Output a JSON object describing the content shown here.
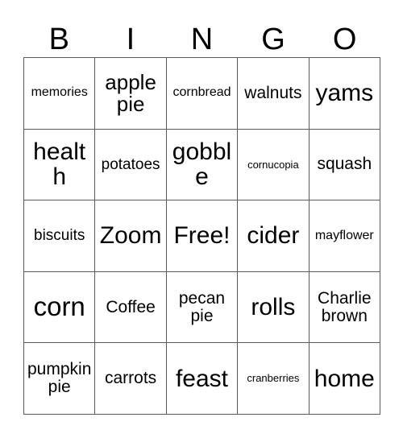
{
  "card": {
    "title": "Bingo Card",
    "header_letters": [
      "B",
      "I",
      "N",
      "G",
      "O"
    ],
    "border_color": "#5a5a5a",
    "background_color": "#ffffff",
    "text_color": "#000000",
    "grid_size": "5x5",
    "free_space": "Free!"
  },
  "grid": {
    "rows": [
      {
        "cells": [
          {
            "text": "memories",
            "size": "sz-s"
          },
          {
            "text": "apple pie",
            "size": "sz-l"
          },
          {
            "text": "cornbread",
            "size": "sz-s"
          },
          {
            "text": "walnuts",
            "size": "sz-ml"
          },
          {
            "text": "yams",
            "size": "sz-xl"
          }
        ]
      },
      {
        "cells": [
          {
            "text": "health",
            "size": "sz-xl"
          },
          {
            "text": "potatoes",
            "size": "sz-m"
          },
          {
            "text": "gobble",
            "size": "sz-xl"
          },
          {
            "text": "cornucopia",
            "size": "sz-xs"
          },
          {
            "text": "squash",
            "size": "sz-ml"
          }
        ]
      },
      {
        "cells": [
          {
            "text": "biscuits",
            "size": "sz-m"
          },
          {
            "text": "Zoom",
            "size": "sz-xl"
          },
          {
            "text": "Free!",
            "size": "sz-xl"
          },
          {
            "text": "cider",
            "size": "sz-xl"
          },
          {
            "text": "mayflower",
            "size": "sz-s"
          }
        ]
      },
      {
        "cells": [
          {
            "text": "corn",
            "size": "sz-xxl"
          },
          {
            "text": "Coffee",
            "size": "sz-ml"
          },
          {
            "text": "pecan pie",
            "size": "sz-ml"
          },
          {
            "text": "rolls",
            "size": "sz-xl"
          },
          {
            "text": "Charlie brown",
            "size": "sz-ml"
          }
        ]
      },
      {
        "cells": [
          {
            "text": "pumpkin pie",
            "size": "sz-ml"
          },
          {
            "text": "carrots",
            "size": "sz-ml"
          },
          {
            "text": "feast",
            "size": "sz-xl"
          },
          {
            "text": "cranberries",
            "size": "sz-xs"
          },
          {
            "text": "home",
            "size": "sz-xl"
          }
        ]
      }
    ]
  }
}
